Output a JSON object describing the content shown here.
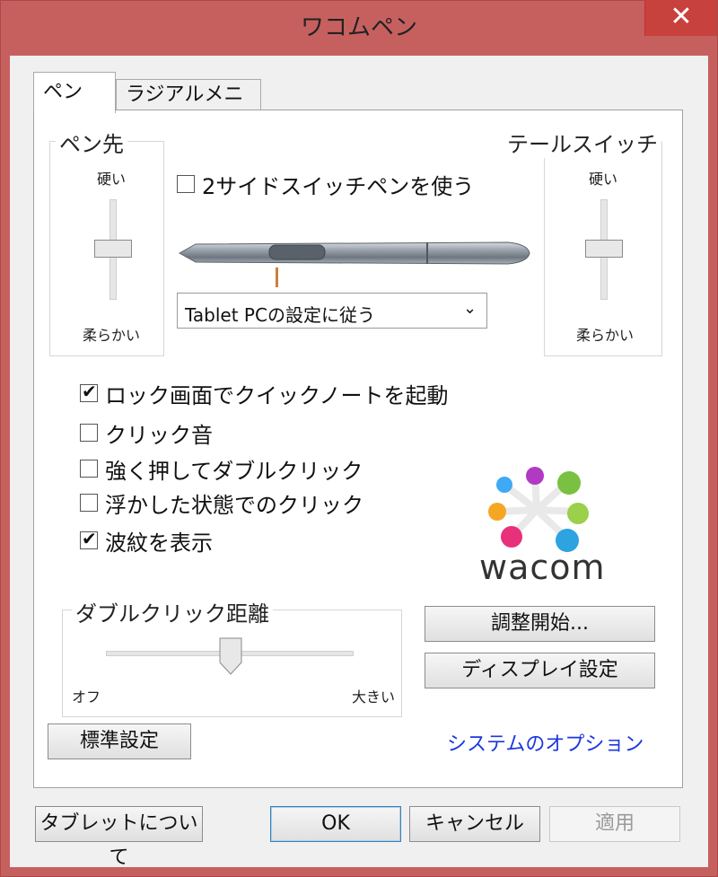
{
  "window": {
    "title": "ワコムペン",
    "close_label": "✕"
  },
  "tabs": [
    {
      "label": "ペン"
    },
    {
      "label": "ラジアルメニュー"
    }
  ],
  "pen_tip": {
    "title": "ペン先",
    "top_label": "硬い",
    "bottom_label": "柔らかい"
  },
  "tail_switch": {
    "title": "テールスイッチ",
    "top_label": "硬い",
    "bottom_label": "柔らかい"
  },
  "two_side_switch": {
    "label": "2サイドスイッチペンを使う",
    "checked": false
  },
  "pen_button_select": {
    "value": "Tablet PCの設定に従う"
  },
  "options": [
    {
      "label": "ロック画面でクイックノートを起動",
      "checked": true
    },
    {
      "label": "クリック音",
      "checked": false
    },
    {
      "label": "強く押してダブルクリック",
      "checked": false
    },
    {
      "label": "浮かした状態でのクリック",
      "checked": false
    },
    {
      "label": "波紋を表示",
      "checked": true
    }
  ],
  "logo": {
    "text": "wacom"
  },
  "double_click": {
    "title": "ダブルクリック距離",
    "left_label": "オフ",
    "right_label": "大きい"
  },
  "buttons": {
    "calibrate": "調整開始...",
    "display_settings": "ディスプレイ設定",
    "defaults": "標準設定",
    "system_options": "システムのオプション",
    "about_tablet": "タブレットについて",
    "ok": "OK",
    "cancel": "キャンセル",
    "apply": "適用"
  },
  "colors": {
    "frame": "#c6605f",
    "close": "#c7413d",
    "link": "#1a36e0"
  }
}
